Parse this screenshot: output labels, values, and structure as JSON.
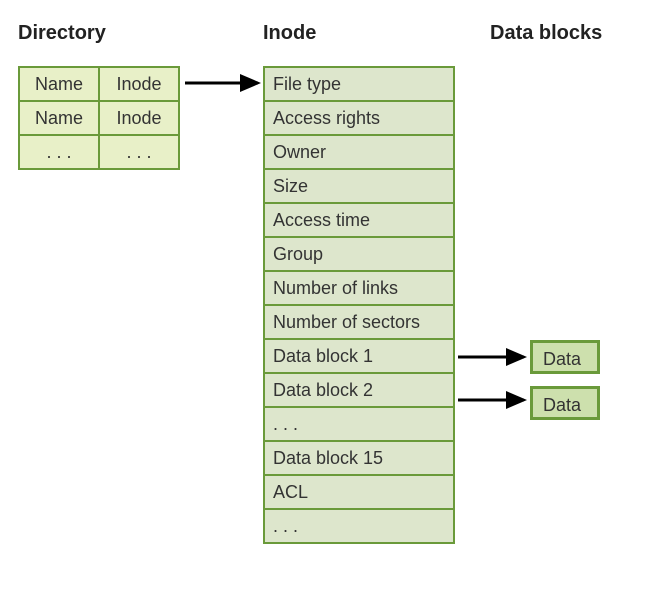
{
  "headings": {
    "directory": "Directory",
    "inode": "Inode",
    "datablocks": "Data blocks"
  },
  "directory": {
    "rows": [
      {
        "name": "Name",
        "inode": "Inode"
      },
      {
        "name": "Name",
        "inode": "Inode"
      },
      {
        "name": ". . .",
        "inode": ". . ."
      }
    ]
  },
  "inode": {
    "fields": [
      "File type",
      "Access rights",
      "Owner",
      "Size",
      "Access time",
      "Group",
      "Number of links",
      "Number of sectors",
      "Data block 1",
      "Data block 2",
      ". . .",
      "Data block 15",
      "ACL",
      ". . ."
    ]
  },
  "datablocks": {
    "items": [
      "Data",
      "Data"
    ]
  }
}
